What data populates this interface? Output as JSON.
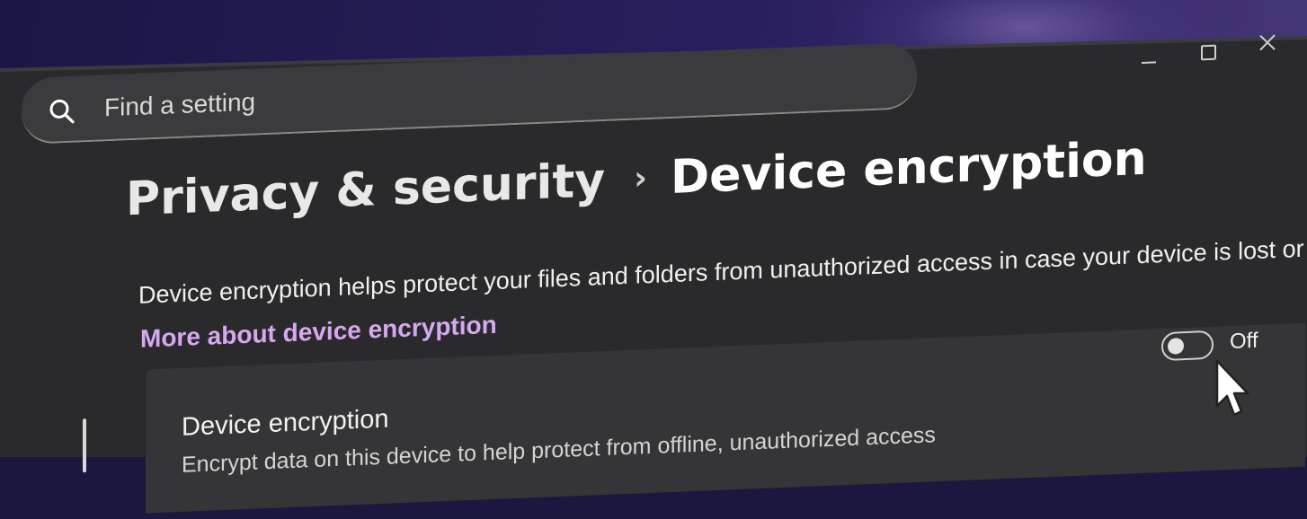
{
  "search": {
    "placeholder": "Find a setting"
  },
  "window_controls": {
    "minimize": "minimize-icon",
    "maximize": "maximize-icon",
    "close": "close-icon"
  },
  "breadcrumb": {
    "parent": "Privacy & security",
    "separator": "›",
    "current": "Device encryption"
  },
  "description": {
    "text": "Device encryption helps protect your files and folders from unauthorized access in case your device is lost or stolen.",
    "link": "More about device encryption"
  },
  "setting_card": {
    "title": "Device encryption",
    "description": "Encrypt data on this device to help protect from offline, unauthorized access",
    "toggle_state": "Off",
    "toggle_on": false
  },
  "colors": {
    "window_bg": "#2a2a2c",
    "card_bg": "#353538",
    "link": "#d6a8f0",
    "backdrop": "#2a1f5e"
  }
}
